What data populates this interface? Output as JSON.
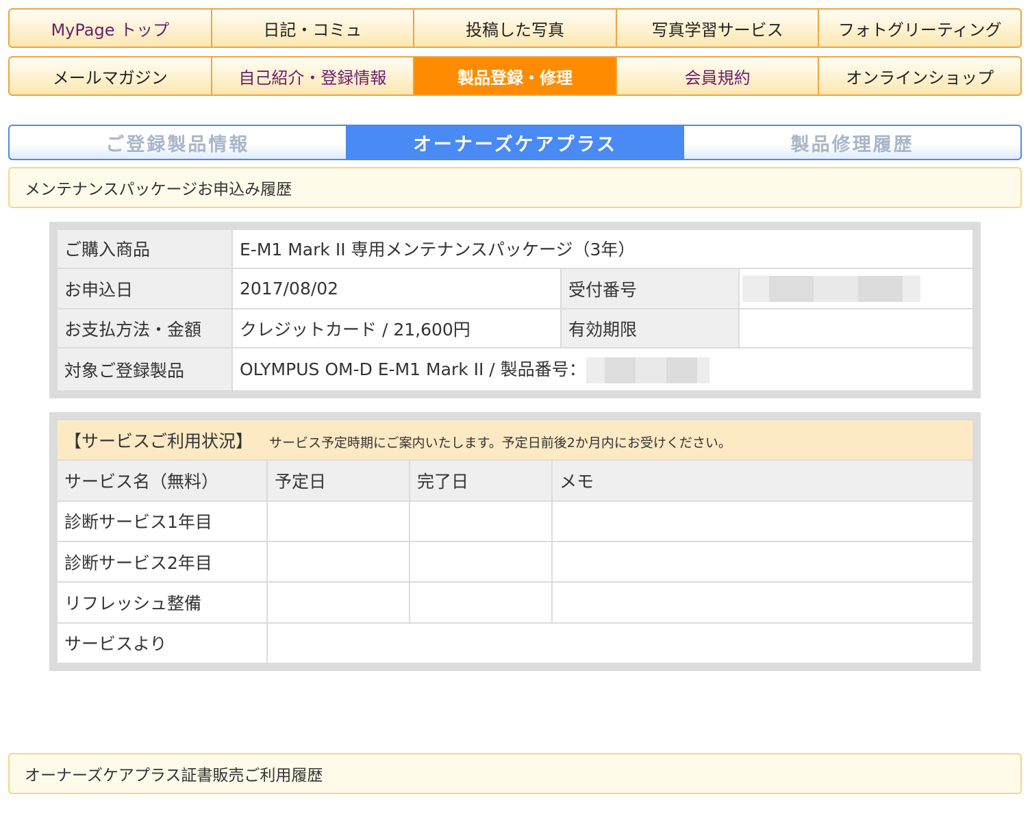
{
  "top_menu": {
    "row1": [
      "MyPage トップ",
      "日記・コミュ",
      "投稿した写真",
      "写真学習サービス",
      "フォトグリーティング"
    ],
    "row2": [
      "メールマガジン",
      "自己紹介・登録情報",
      "製品登録・修理",
      "会員規約",
      "オンラインショップ"
    ],
    "active": "製品登録・修理"
  },
  "sub_tabs": [
    "ご登録製品情報",
    "オーナーズケアプラス",
    "製品修理履歴"
  ],
  "active_sub_tab": "オーナーズケアプラス",
  "section1_title": "メンテナンスパッケージお申込み履歴",
  "purchase": {
    "product_label": "ご購入商品",
    "product_value": "E-M1 Mark II 専用メンテナンスパッケージ（3年）",
    "date_label": "お申込日",
    "date_value": "2017/08/02",
    "receipt_label": "受付番号",
    "payment_label": "お支払方法・金額",
    "payment_value": "クレジットカード / 21,600円",
    "expiry_label": "有効期限",
    "target_label": "対象ご登録製品",
    "target_value": "OLYMPUS OM-D E-M1 Mark II / 製品番号："
  },
  "service_status": {
    "title": "【サービスご利用状況】",
    "note": "サービス予定時期にご案内いたします。予定日前後2か月内にお受けください。",
    "columns": [
      "サービス名（無料）",
      "予定日",
      "完了日",
      "メモ"
    ],
    "rows": [
      "診断サービス1年目",
      "診断サービス2年目",
      "リフレッシュ整備"
    ],
    "from_service_label": "サービスより"
  },
  "section2_title": "オーナーズケアプラス証書販売ご利用履歴",
  "colors": {
    "menu_active": "#ff8c00",
    "menu_border": "#f0a43c",
    "tab_active": "#4a8af4"
  }
}
